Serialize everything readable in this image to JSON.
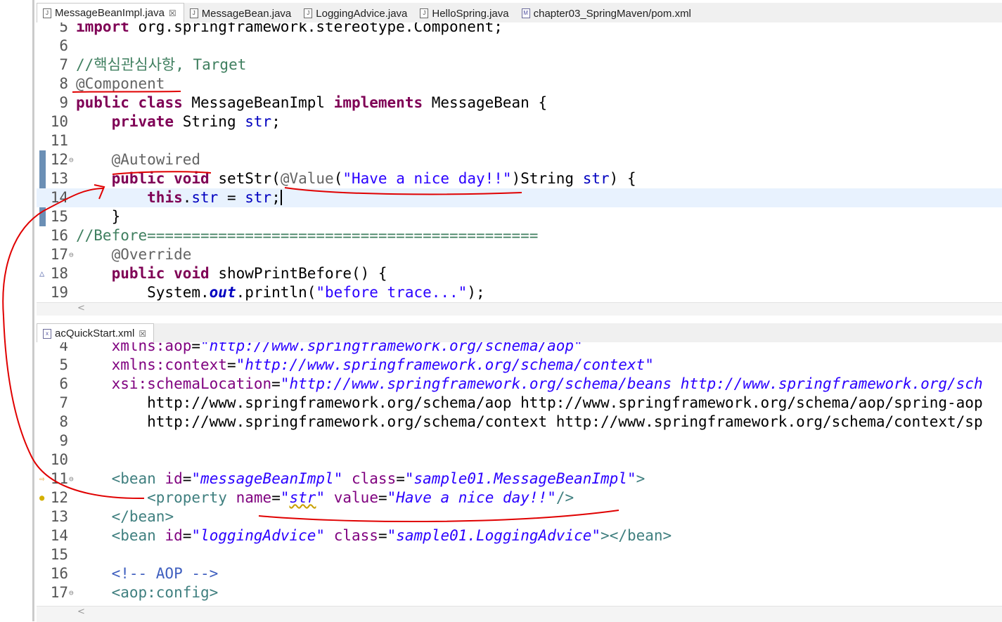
{
  "top_tabs": [
    {
      "label": "MessageBeanImpl.java",
      "icon": "java-file-icon",
      "active": true,
      "closable": true
    },
    {
      "label": "MessageBean.java",
      "icon": "java-file-icon"
    },
    {
      "label": "LoggingAdvice.java",
      "icon": "java-file-icon"
    },
    {
      "label": "HelloSpring.java",
      "icon": "java-file-icon"
    },
    {
      "label": "chapter03_SpringMaven/pom.xml",
      "icon": "maven-file-icon"
    }
  ],
  "bottom_tabs": [
    {
      "label": "acQuickStart.xml",
      "icon": "xml-file-icon",
      "active": true,
      "closable": true
    }
  ],
  "close_glyph": "☒",
  "java_editor": {
    "lines": [
      {
        "n": "5",
        "t": "import org.springframework.stereotype.Component;"
      },
      {
        "n": "6",
        "t": ""
      },
      {
        "n": "7",
        "t": "//핵심관심사항, Target"
      },
      {
        "n": "8",
        "t": "@Component"
      },
      {
        "n": "9",
        "t": "public class MessageBeanImpl implements MessageBean {"
      },
      {
        "n": "10",
        "t": "    private String str;"
      },
      {
        "n": "11",
        "t": ""
      },
      {
        "n": "12",
        "t": "    @Autowired"
      },
      {
        "n": "13",
        "t": "    public void setStr(@Value(\"Have a nice day!!\")String str) {"
      },
      {
        "n": "14",
        "t": "        this.str = str;"
      },
      {
        "n": "15",
        "t": "    }"
      },
      {
        "n": "16",
        "t": "//Before============================================"
      },
      {
        "n": "17",
        "t": "    @Override"
      },
      {
        "n": "18",
        "t": "    public void showPrintBefore() {"
      },
      {
        "n": "19",
        "t": "        System.out.println(\"before trace...\");"
      }
    ]
  },
  "xml_editor": {
    "lines": [
      {
        "n": "4",
        "t": "    xmlns:aop=\"http://www.springframework.org/schema/aop\""
      },
      {
        "n": "5",
        "t": "    xmlns:context=\"http://www.springframework.org/schema/context\""
      },
      {
        "n": "6",
        "t": "    xsi:schemaLocation=\"http://www.springframework.org/schema/beans http://www.springframework.org/sch"
      },
      {
        "n": "7",
        "t": "        http://www.springframework.org/schema/aop http://www.springframework.org/schema/aop/spring-aop"
      },
      {
        "n": "8",
        "t": "        http://www.springframework.org/schema/context http://www.springframework.org/schema/context/sp"
      },
      {
        "n": "9",
        "t": ""
      },
      {
        "n": "10",
        "t": ""
      },
      {
        "n": "11",
        "t": "    <bean id=\"messageBeanImpl\" class=\"sample01.MessageBeanImpl\">"
      },
      {
        "n": "12",
        "t": "        <property name=\"str\" value=\"Have a nice day!!\"/>"
      },
      {
        "n": "13",
        "t": "    </bean>"
      },
      {
        "n": "14",
        "t": "    <bean id=\"loggingAdvice\" class=\"sample01.LoggingAdvice\"></bean>"
      },
      {
        "n": "15",
        "t": ""
      },
      {
        "n": "16",
        "t": "    <!-- AOP -->"
      },
      {
        "n": "17",
        "t": "    <aop:config>"
      }
    ]
  },
  "colors": {
    "keyword": "#7f0055",
    "annotation": "#646464",
    "comment": "#3f7f5f",
    "string": "#2a00ff",
    "field": "#0000c0",
    "xml_tag": "#3f7f7f",
    "xml_attr": "#7f007f",
    "xml_value": "#2a00ff",
    "current_line": "#e8f2fe",
    "pen_annotation": "#e00000"
  }
}
